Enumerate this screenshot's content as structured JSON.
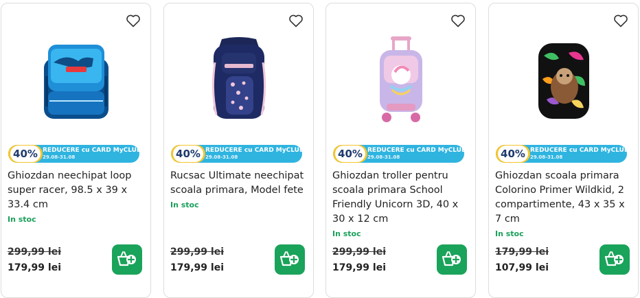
{
  "products": [
    {
      "title": "Ghiozdan neechipat loop super racer, 98.5 x 39 x 33.4 cm",
      "promo_percent": "40%",
      "promo_text": "REDUCERE cu CARD MyCLUB",
      "promo_date": "29.08-31.08",
      "stock": "In stoc",
      "old_price": "299,99 lei",
      "new_price": "179,99 lei"
    },
    {
      "title": "Rucsac Ultimate neechipat scoala primara, Model fete",
      "promo_percent": "40%",
      "promo_text": "REDUCERE cu CARD MyCLUB",
      "promo_date": "29.08-31.08",
      "stock": "In stoc",
      "old_price": "299,99 lei",
      "new_price": "179,99 lei"
    },
    {
      "title": "Ghiozdan troller pentru scoala primara School Friendly Unicorn 3D, 40 x 30 x 12 cm",
      "promo_percent": "40%",
      "promo_text": "REDUCERE cu CARD MyCLUB",
      "promo_date": "29.08-31.08",
      "stock": "In stoc",
      "old_price": "299,99 lei",
      "new_price": "179,99 lei"
    },
    {
      "title": "Ghiozdan scoala primara Colorino Primer Wildkid, 2 compartimente, 43 x 35 x 7 cm",
      "promo_percent": "40%",
      "promo_text": "REDUCERE cu CARD MyCLUB",
      "promo_date": "29.08-31.08",
      "stock": "In stoc",
      "old_price": "179,99 lei",
      "new_price": "107,99 lei"
    }
  ],
  "colors": {
    "promo_blue": "#2fb4e0",
    "promo_yellow": "#f6c52e",
    "stock_green": "#1aa05a",
    "cart_green": "#1aa35a"
  },
  "icons": {
    "favorite": "heart-outline-icon",
    "cart": "basket-plus-icon"
  }
}
